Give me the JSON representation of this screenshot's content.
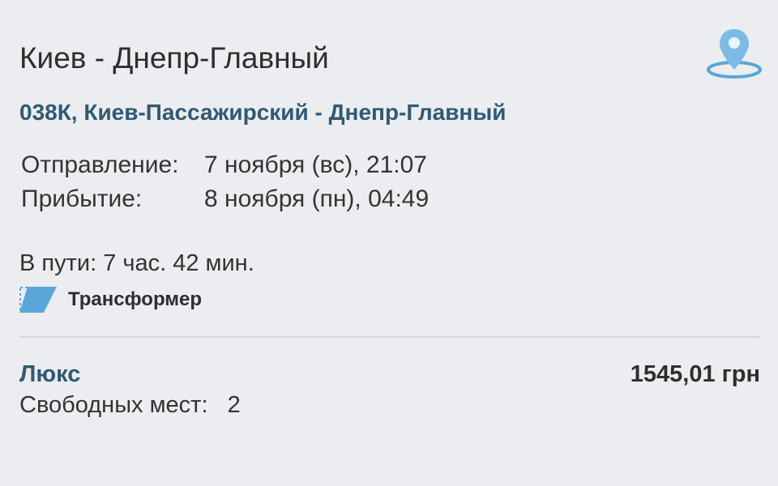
{
  "route": {
    "title": "Киев - Днепр-Главный",
    "map_icon": "map-pin-icon"
  },
  "train": {
    "line": "038К, Киев-Пассажирский - Днепр-Главный"
  },
  "schedule": {
    "departure_label": "Отправление:",
    "departure_value": "7 ноября (вс), 21:07",
    "arrival_label": "Прибытие:",
    "arrival_value": "8 ноября (пн), 04:49"
  },
  "duration": "В пути: 7 час. 42 мин.",
  "tag": {
    "label": "Трансформер",
    "icon": "transformer-icon"
  },
  "seat_class": {
    "name": "Люкс",
    "price": "1545,01 грн",
    "available_label": "Свободных мест:",
    "available_count": "2"
  },
  "colors": {
    "background": "#ecedf0",
    "accent": "#2f5a72",
    "icon_blue": "#5aa6d8",
    "text": "#333333"
  }
}
